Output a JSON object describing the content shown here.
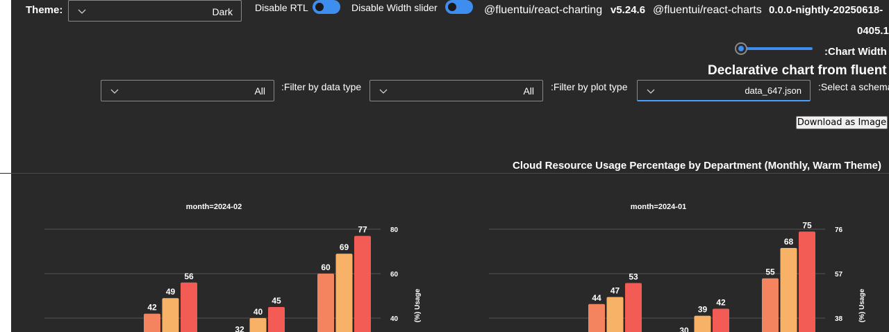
{
  "theme": {
    "label": "Theme:",
    "value": "Dark"
  },
  "toggles": {
    "rtl_label": "Disable RTL",
    "width_label": "Disable Width slider"
  },
  "versions": {
    "charting_pkg": "@fluentui/react-charting",
    "charting_ver": "v5.24.6",
    "charts_pkg": "@fluentui/react-charts",
    "charts_ver_line1": "0.0.0-nightly-20250618-",
    "charts_ver_line2": "0405.1"
  },
  "chart_width": {
    "label": ":Chart Width"
  },
  "heading": "Declarative chart from fluent",
  "filters": {
    "data_type_value": "All",
    "data_type_label": ":Filter by data type",
    "plot_type_value": "All",
    "plot_type_label": ":Filter by plot type",
    "schema_value": "data_647.json",
    "schema_label": ":Select a schema"
  },
  "download_button": "Download as Image",
  "chart_title": "Cloud Resource Usage Percentage by Department (Monthly, Warm Theme)",
  "colors": {
    "s1": "#f4845f",
    "s2": "#f7b267",
    "s3": "#f25c54",
    "grid": "#555555"
  },
  "chart_data": [
    {
      "type": "bar",
      "title": "month=2024-02",
      "ylabel": "(%) Usage",
      "yticks": [
        40,
        60,
        80
      ],
      "ylim": [
        35,
        80
      ],
      "groups": [
        {
          "values": [
            42,
            49,
            56
          ]
        },
        {
          "values": [
            32,
            40,
            45
          ]
        },
        {
          "values": [
            60,
            69,
            77
          ]
        }
      ]
    },
    {
      "type": "bar",
      "title": "month=2024-01",
      "ylabel": "(%) Usage",
      "yticks": [
        38,
        57,
        76
      ],
      "ylim": [
        33,
        76
      ],
      "groups": [
        {
          "values": [
            44,
            47,
            53
          ]
        },
        {
          "values": [
            30,
            39,
            42
          ]
        },
        {
          "values": [
            55,
            68,
            75
          ]
        }
      ]
    }
  ]
}
